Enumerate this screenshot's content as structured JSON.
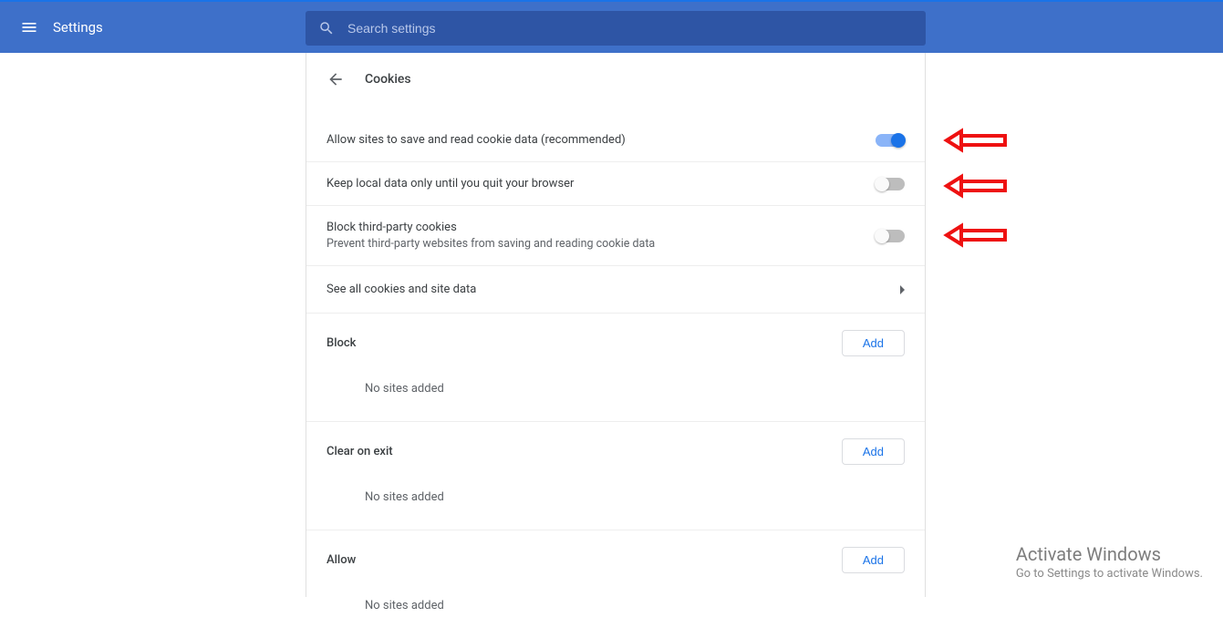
{
  "header": {
    "title": "Settings",
    "search_placeholder": "Search settings"
  },
  "page": {
    "title": "Cookies"
  },
  "settings": {
    "allow_cookies": {
      "label": "Allow sites to save and read cookie data (recommended)",
      "on": true
    },
    "keep_local": {
      "label": "Keep local data only until you quit your browser",
      "on": false
    },
    "block_third": {
      "label": "Block third-party cookies",
      "sub": "Prevent third-party websites from saving and reading cookie data",
      "on": false
    },
    "see_all": {
      "label": "See all cookies and site data"
    }
  },
  "sections": {
    "block": {
      "title": "Block",
      "add": "Add",
      "empty": "No sites added"
    },
    "clear_exit": {
      "title": "Clear on exit",
      "add": "Add",
      "empty": "No sites added"
    },
    "allow": {
      "title": "Allow",
      "add": "Add",
      "empty": "No sites added"
    }
  },
  "watermark": {
    "line1": "Activate Windows",
    "line2": "Go to Settings to activate Windows."
  }
}
